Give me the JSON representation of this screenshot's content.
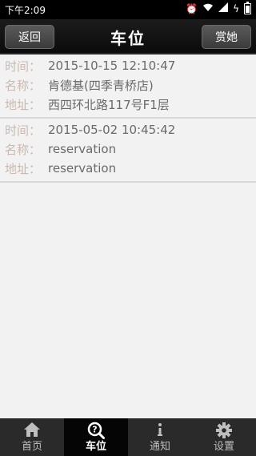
{
  "status_bar": {
    "time": "下午2:09"
  },
  "header": {
    "back_label": "返回",
    "title": "车位",
    "tip_label": "赏她"
  },
  "records": [
    {
      "time_label": "时间：",
      "time_value": "2015-10-15 12:10:47",
      "name_label": "名称：",
      "name_value": "肯德基(四季青桥店)",
      "address_label": "地址：",
      "address_value": "西四环北路117号F1层"
    },
    {
      "time_label": "时间：",
      "time_value": "2015-05-02 10:45:42",
      "name_label": "名称：",
      "name_value": "reservation",
      "address_label": "地址：",
      "address_value": "reservation"
    }
  ],
  "tabs": [
    {
      "label": "首页",
      "icon": "home-icon"
    },
    {
      "label": "车位",
      "icon": "search-help-icon"
    },
    {
      "label": "通知",
      "icon": "info-icon"
    },
    {
      "label": "设置",
      "icon": "gear-icon"
    }
  ],
  "colors": {
    "label": "#c9b9b1",
    "value": "#6a6a6a",
    "header_bg": "#111111",
    "tab_active": "#050505"
  }
}
